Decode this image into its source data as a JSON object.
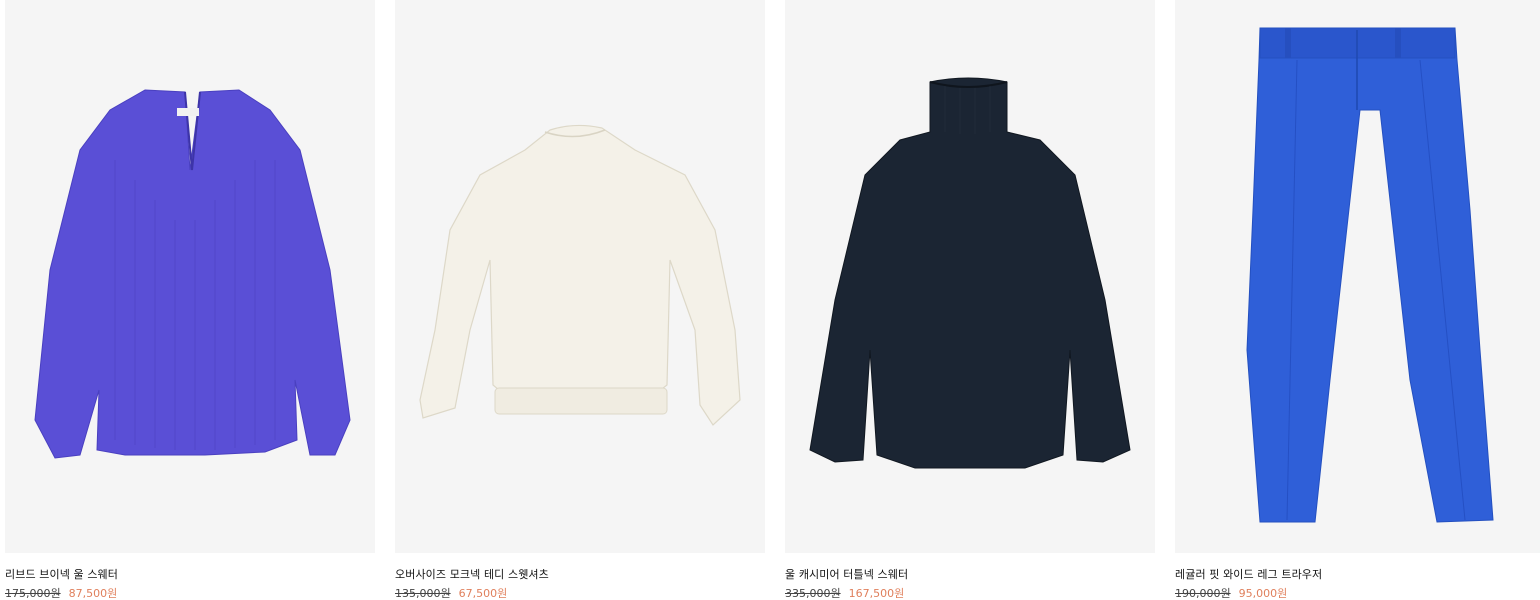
{
  "products": [
    {
      "name": "리브드 브이넥 울 스웨터",
      "original_price": "175,000원",
      "sale_price": "87,500원",
      "garment_color": "#5a4fd6",
      "garment_icon": "v-neck-sweater"
    },
    {
      "name": "오버사이즈 모크넥 테디 스웻셔츠",
      "original_price": "135,000원",
      "sale_price": "67,500원",
      "garment_color": "#f4f1e8",
      "garment_icon": "mock-neck-sweatshirt"
    },
    {
      "name": "울 캐시미어 터틀넥 스웨터",
      "original_price": "335,000원",
      "sale_price": "167,500원",
      "garment_color": "#1b2533",
      "garment_icon": "turtleneck-sweater"
    },
    {
      "name": "레귤러 핏 와이드 레그 트라우저",
      "original_price": "190,000원",
      "sale_price": "95,000원",
      "garment_color": "#2f5fd8",
      "garment_icon": "wide-leg-trousers"
    }
  ],
  "colors": {
    "image_background": "#f5f5f5",
    "sale_price": "#e0805d",
    "text": "#111111"
  }
}
